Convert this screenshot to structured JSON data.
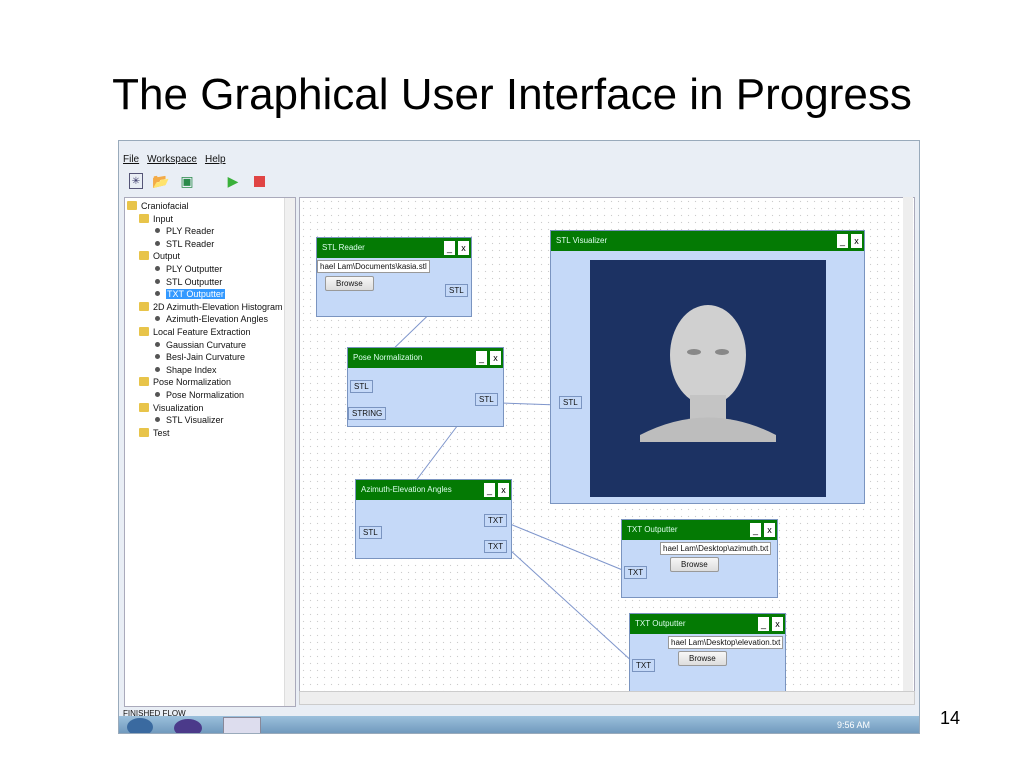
{
  "slide": {
    "title": "The Graphical User Interface in Progress",
    "page_number": "14"
  },
  "menu": [
    "File",
    "Workspace",
    "Help"
  ],
  "tree": [
    {
      "label": "Craniofacial",
      "type": "folder",
      "level": 0
    },
    {
      "label": "Input",
      "type": "folder",
      "level": 1
    },
    {
      "label": "PLY Reader",
      "type": "leaf",
      "level": 2
    },
    {
      "label": "STL Reader",
      "type": "leaf",
      "level": 2
    },
    {
      "label": "Output",
      "type": "folder",
      "level": 1
    },
    {
      "label": "PLY Outputter",
      "type": "leaf",
      "level": 2
    },
    {
      "label": "STL Outputter",
      "type": "leaf",
      "level": 2
    },
    {
      "label": "TXT Outputter",
      "type": "leaf",
      "level": 2,
      "selected": true
    },
    {
      "label": "2D Azimuth-Elevation Histogram",
      "type": "folder",
      "level": 1
    },
    {
      "label": "Azimuth-Elevation Angles",
      "type": "leaf",
      "level": 2
    },
    {
      "label": "Local Feature Extraction",
      "type": "folder",
      "level": 1
    },
    {
      "label": "Gaussian Curvature",
      "type": "leaf",
      "level": 2
    },
    {
      "label": "Besl-Jain Curvature",
      "type": "leaf",
      "level": 2
    },
    {
      "label": "Shape Index",
      "type": "leaf",
      "level": 2
    },
    {
      "label": "Pose Normalization",
      "type": "folder",
      "level": 1
    },
    {
      "label": "Pose Normalization",
      "type": "leaf",
      "level": 2
    },
    {
      "label": "Visualization",
      "type": "folder",
      "level": 1
    },
    {
      "label": "STL Visualizer",
      "type": "leaf",
      "level": 2
    },
    {
      "label": "Test",
      "type": "folder",
      "level": 1
    }
  ],
  "nodes": {
    "stl_reader": {
      "title": "STL Reader",
      "path": "hael Lam\\Documents\\kasia.stl",
      "browse": "Browse",
      "out": "STL"
    },
    "pose": {
      "title": "Pose Normalization",
      "in1": "STL",
      "in2": "STRING",
      "out": "STL"
    },
    "az": {
      "title": "Azimuth-Elevation Angles",
      "in": "STL",
      "out1": "TXT",
      "out2": "TXT"
    },
    "viz": {
      "title": "STL Visualizer",
      "in": "STL"
    },
    "txt1": {
      "title": "TXT Outputter",
      "path": "hael Lam\\Desktop\\azimuth.txt",
      "browse": "Browse",
      "in": "TXT"
    },
    "txt2": {
      "title": "TXT Outputter",
      "path": "hael Lam\\Desktop\\elevation.txt",
      "browse": "Browse",
      "in": "TXT"
    },
    "min": "_",
    "close": "x"
  },
  "status": "FINISHED FLOW",
  "clock": "9:56 AM"
}
